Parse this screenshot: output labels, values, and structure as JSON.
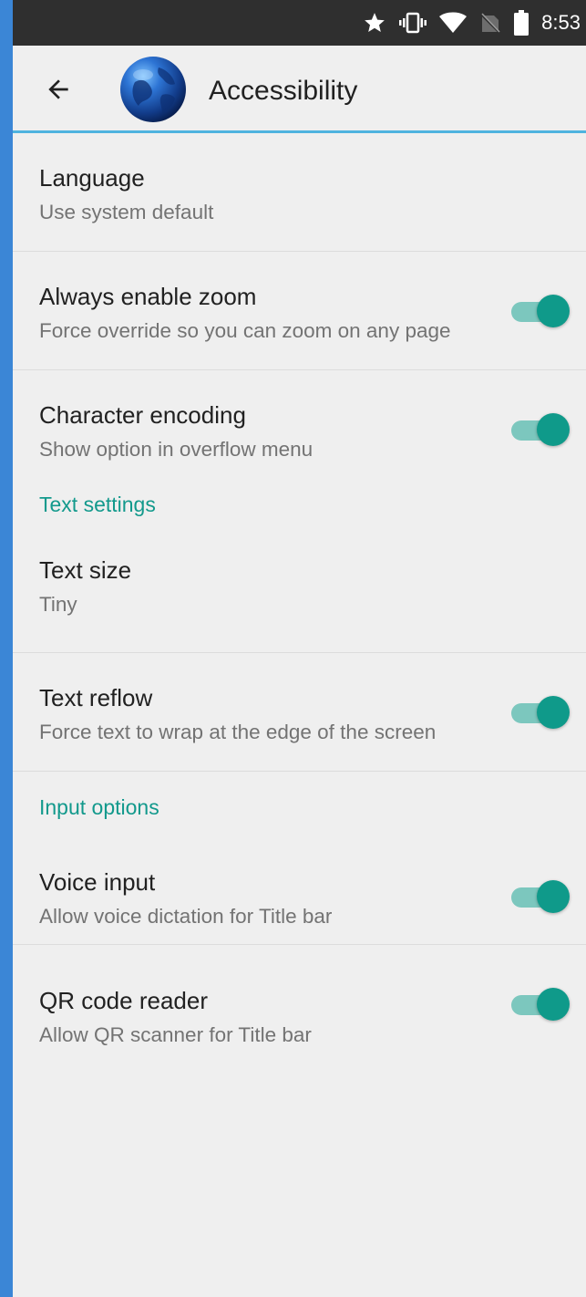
{
  "status_bar": {
    "time": "8:53",
    "icons": [
      "star-icon",
      "vibrate-icon",
      "wifi-icon",
      "no-sim-icon",
      "battery-icon"
    ]
  },
  "app_bar": {
    "title": "Accessibility",
    "back_icon": "arrow-left-icon",
    "logo_icon": "globe-logo"
  },
  "colors": {
    "accent": "#12998c",
    "switch_thumb": "#0f9a8a",
    "switch_track": "#7cc7be",
    "divider_accent": "#4fb3df",
    "status_bar": "#2f2f2f",
    "background": "#efefef"
  },
  "settings": {
    "language": {
      "title": "Language",
      "summary": "Use system default"
    },
    "zoom": {
      "title": "Always enable zoom",
      "summary": "Force override so you can zoom on any page",
      "enabled": true
    },
    "encoding": {
      "title": "Character encoding",
      "summary": "Show option in overflow menu",
      "enabled": true
    },
    "text_header": "Text settings",
    "text_size": {
      "title": "Text size",
      "summary": "Tiny"
    },
    "text_reflow": {
      "title": "Text reflow",
      "summary": "Force text to wrap at the edge of the screen",
      "enabled": true
    },
    "input_header": "Input options",
    "voice_input": {
      "title": "Voice input",
      "summary": "Allow voice dictation for Title bar",
      "enabled": true
    },
    "qr_reader": {
      "title": "QR code reader",
      "summary": "Allow QR scanner for Title bar",
      "enabled": true
    }
  }
}
